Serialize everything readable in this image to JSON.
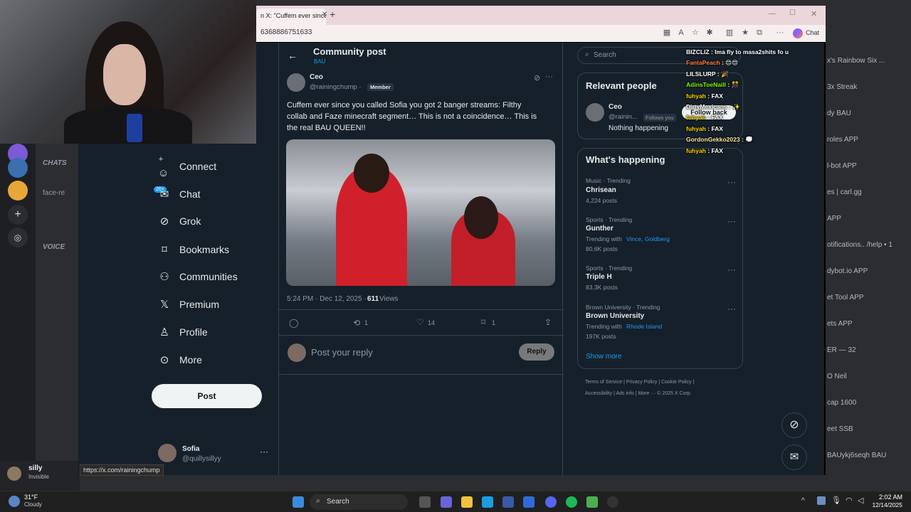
{
  "browser": {
    "tab_title": "n X: \"Cuffem ever since",
    "url": "6368886751633",
    "copilot_label": "Chat"
  },
  "x_nav": {
    "items": [
      {
        "label": "Connect",
        "icon": "connect-icon"
      },
      {
        "label": "Chat",
        "icon": "mail-icon"
      },
      {
        "label": "Grok",
        "icon": "grok-icon"
      },
      {
        "label": "Bookmarks",
        "icon": "bookmark-icon"
      },
      {
        "label": "Communities",
        "icon": "communities-icon"
      },
      {
        "label": "Premium",
        "icon": "x-logo-icon"
      },
      {
        "label": "Profile",
        "icon": "profile-icon"
      },
      {
        "label": "More",
        "icon": "more-circle-icon"
      }
    ],
    "chat_badge": "20+",
    "post_button": "Post",
    "account_name": "Sofia",
    "account_handle": "@quillysillyy"
  },
  "post": {
    "header_title": "Community post",
    "community": "BAU",
    "author_name": "Ceo",
    "author_handle": "@rainingchump ·",
    "member_badge": "Member",
    "text_line1": "Cuffem ever since you called Sofia you got 2 banger streams: Filthy",
    "text_line2": "collab and Faze minecraft segment… This is not a coincidence… This is",
    "text_line3": "the real BAU QUEEN!!",
    "timestamp": "5:24 PM · Dec 12, 2025 ·",
    "views_count": "611",
    "views_label": "Views",
    "replies": "",
    "reposts": "1",
    "likes": "14",
    "bookmarks": "1",
    "reply_placeholder": "Post your reply",
    "reply_button": "Reply"
  },
  "right": {
    "search_placeholder": "Search",
    "relevant_title": "Relevant people",
    "relevant_name": "Ceo",
    "relevant_handle": "@rainin...",
    "follows_you": "Follows you",
    "follow_back": "Follow back",
    "relevant_bio": "Nothing happening",
    "happening_title": "What's happening",
    "trends": [
      {
        "meta": "Music · Trending",
        "name": "Chrisean",
        "posts": "4,224 posts",
        "with": ""
      },
      {
        "meta": "Sports · Trending",
        "name": "Gunther",
        "posts": "80.6K posts",
        "with": "Trending with",
        "links": "Vince, Goldberg"
      },
      {
        "meta": "Sports · Trending",
        "name": "Triple H",
        "posts": "83.3K posts",
        "with": ""
      },
      {
        "meta": "Brown University · Trending",
        "name": "Brown University",
        "posts": "197K posts",
        "with": "Trending with",
        "links": "Rhode Island"
      }
    ],
    "show_more": "Show more",
    "footer1": "Terms of Service  |  Privacy Policy  |  Cookie Policy  |",
    "footer2": "Accessibility  |  Ads info  |  More ···   © 2025 X Corp."
  },
  "stream_chat": [
    {
      "user": "BIZCLIZ",
      "msg": ": Ima fly to masa2shits fo u",
      "color": "#ffffff"
    },
    {
      "user": "FantaPeach",
      "msg": ": 😍😍",
      "color": "#ff7a3d"
    },
    {
      "user": "LILSLURP",
      "msg": ": 🎉",
      "color": "#ffffff"
    },
    {
      "user": "AdinsToeNaill",
      "msg": ": 🎊",
      "color": "#7cfc00"
    },
    {
      "user": "fuhyah",
      "msg": ": FAX",
      "color": "#ffd400"
    },
    {
      "user": "DirtyMexicans",
      "msg": ": ✨",
      "color": "#ffffff"
    },
    {
      "user": "fuhyah",
      "msg": ": FAX",
      "color": "#ffd400"
    },
    {
      "user": "fuhyah",
      "msg": ": FAX",
      "color": "#ffd400"
    },
    {
      "user": "GordonGekko2023",
      "msg": ": 💭",
      "color": "#ffe39a"
    },
    {
      "user": "fuhyah",
      "msg": ": FAX",
      "color": "#ffd400"
    }
  ],
  "discord": {
    "channels": [
      "CHATS",
      "face-re",
      "VOICE"
    ],
    "user_name": "silly",
    "user_status": "Invisible",
    "right_list": [
      "x's Rainbow Six ...",
      "3x Streak",
      "dy  BAU",
      "roles APP",
      "l-bot APP",
      "es | carl.gg",
      "APP",
      "otifications.. /help • 1",
      "dybot.io APP",
      "et Tool APP",
      "ets APP",
      "ER — 32",
      "O Neil",
      "cap  1600",
      "eet  SSB",
      "BAUykj6seqh  BAU"
    ]
  },
  "status_url": "https://x.com/rainingchump",
  "taskbar": {
    "weather_temp": "31°F",
    "weather_desc": "Cloudy",
    "search": "Search",
    "time": "2:02 AM",
    "date": "12/14/2025"
  },
  "colors": {
    "x_bg": "#15202b",
    "accent": "#1d9bf0",
    "border": "#38444d"
  }
}
